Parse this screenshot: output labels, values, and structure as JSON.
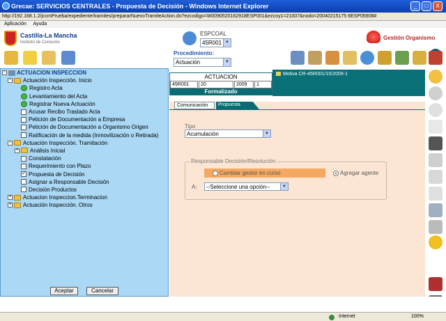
{
  "window": {
    "title": "Grecae: SERVICIOS CENTRALES - Propuesta de Decisión - Windows Internet Explorer",
    "minimize": "_",
    "maximize": "□",
    "close": "X"
  },
  "address": {
    "url": "http://192.168.1.2/jccmPrueba/expediente/tramites/prepararNuevoTramiteAction.do?ezcodigo=W0090520162918ESP001&ezcoy1=21007&nodo=20040215175 6ESP05908#"
  },
  "menu": {
    "items": [
      "Aplicación",
      "Ayuda"
    ]
  },
  "header": {
    "logo_title": "Castilla-La Mancha",
    "logo_sub": "Instituto de Consumo",
    "user_label": "ESPCOAL",
    "user_select": "45R001",
    "gestion_label": "Gestión Organismo",
    "info_glyph": "i",
    "procedimiento_label": "Procedimiento:",
    "procedimiento_select": "Actuación"
  },
  "tree": {
    "root": "ACTUACION INSPECCION",
    "groups": [
      {
        "label": "Actuación Inspección. Inicio",
        "items": [
          {
            "label": "Registro Acta",
            "type": "gear"
          },
          {
            "label": "Levantamiento del Acta",
            "type": "gear"
          },
          {
            "label": "Registrar Nueva Actuación",
            "type": "gear"
          },
          {
            "label": "Acusar Recibo Traslado Acta",
            "type": "box"
          },
          {
            "label": "Petición de Documentación a Empresa",
            "type": "box"
          },
          {
            "label": "Petición de Documentación a Organismo Origen",
            "type": "box"
          },
          {
            "label": "Ratificación de la medida (Inmovilización o Retirada)",
            "type": "box"
          }
        ]
      },
      {
        "label": "Actuación Inspección. Tramitación",
        "items": [
          {
            "label": "Análisis Inicial",
            "type": "folder"
          },
          {
            "label": "Constatación",
            "type": "box"
          },
          {
            "label": "Requerimiento con Plazo",
            "type": "box"
          },
          {
            "label": "Propuesta de Decisión",
            "type": "checked"
          },
          {
            "label": "Asignar a Responsable Decisión",
            "type": "box"
          },
          {
            "label": "Decisión Productos",
            "type": "box"
          }
        ]
      },
      {
        "label": "Actuacion Inspeccion.Terminacion",
        "items": []
      },
      {
        "label": "Actuación Inspección. Otros",
        "items": []
      }
    ],
    "accept_button": "Aceptar",
    "cancel_button": "Cancelar"
  },
  "actuacion": {
    "title": "ACTUACION",
    "cells": [
      "45R001",
      "20",
      "2009",
      "1"
    ],
    "status": "Formalizado",
    "motiva": "Motiva CR-45R001/15/2009-1"
  },
  "form": {
    "tabs": [
      "Comunicación",
      "Propuesta"
    ],
    "tipo_label": "Tipo",
    "tipo_value": "Acumulación",
    "resp_label": "Responsable Decisión/Resolución",
    "opt_cambiar": "Cambiar gestor en curso",
    "opt_agregar": "Agregar agente",
    "a_label": "A:",
    "a_placeholder": "--Seleccione una opción--"
  },
  "status": {
    "internet": "Internet",
    "zoom": "100%"
  }
}
